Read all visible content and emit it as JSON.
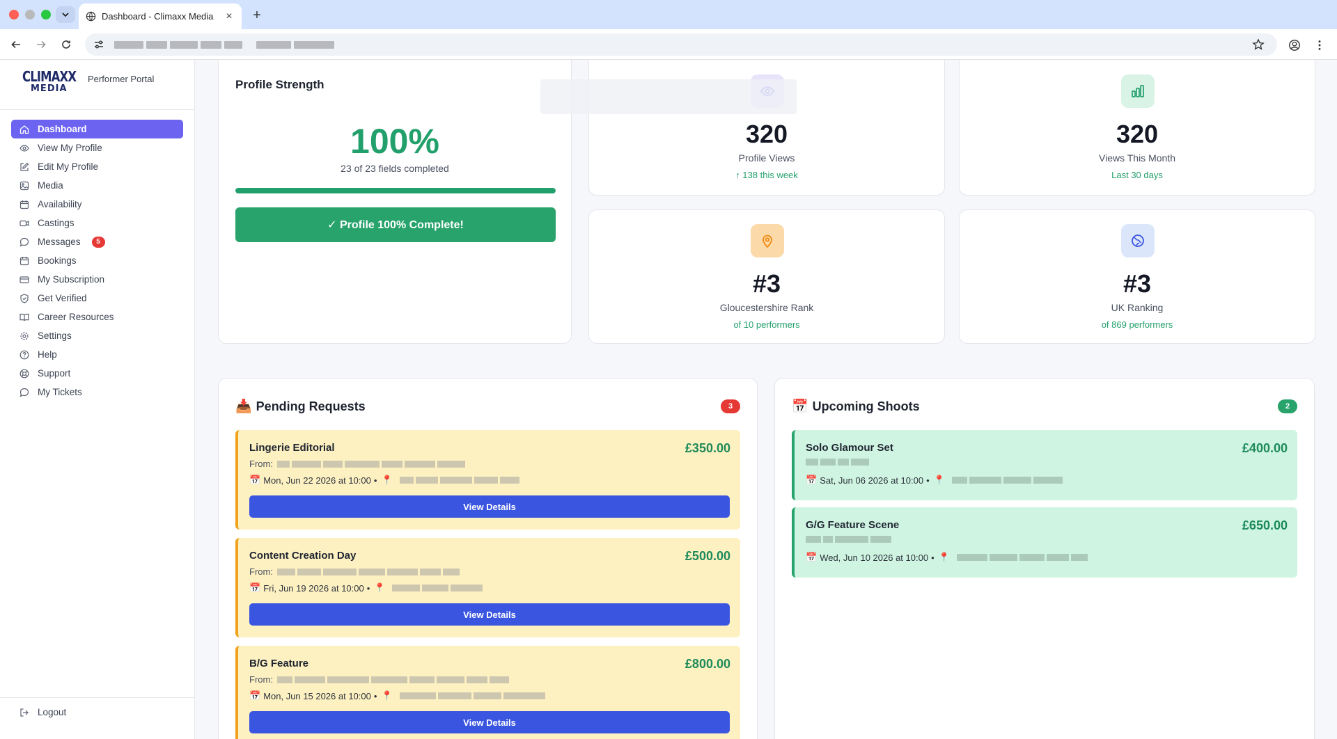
{
  "browser": {
    "tab_title": "Dashboard - Climaxx Media",
    "new_tab_symbol": "+"
  },
  "sidebar": {
    "brand_top": "CLIMAXX",
    "brand_bottom": "MEDIA",
    "portal_label": "Performer Portal",
    "items": [
      {
        "label": "Dashboard",
        "icon": "home-icon",
        "active": true
      },
      {
        "label": "View My Profile",
        "icon": "eye-icon"
      },
      {
        "label": "Edit My Profile",
        "icon": "edit-icon"
      },
      {
        "label": "Media",
        "icon": "image-icon"
      },
      {
        "label": "Availability",
        "icon": "calendar-icon"
      },
      {
        "label": "Castings",
        "icon": "video-icon"
      },
      {
        "label": "Messages",
        "icon": "chat-icon",
        "badge": "5"
      },
      {
        "label": "Bookings",
        "icon": "calendar-icon"
      },
      {
        "label": "My Subscription",
        "icon": "card-icon"
      },
      {
        "label": "Get Verified",
        "icon": "shield-check-icon"
      },
      {
        "label": "Career Resources",
        "icon": "book-icon"
      },
      {
        "label": "Settings",
        "icon": "gear-icon"
      },
      {
        "label": "Help",
        "icon": "help-icon"
      },
      {
        "label": "Support",
        "icon": "lifebuoy-icon"
      },
      {
        "label": "My Tickets",
        "icon": "chat-icon"
      }
    ],
    "logout_label": "Logout"
  },
  "profile_strength": {
    "title": "Profile Strength",
    "percent_text": "100%",
    "progress": 1.0,
    "fields_text": "23 of 23 fields completed",
    "button_label": "✓ Profile 100% Complete!"
  },
  "stats": {
    "views": {
      "value": "320",
      "label": "Profile Views",
      "sub": "↑ 138 this week",
      "icon": "eye-icon"
    },
    "month": {
      "value": "320",
      "label": "Views This Month",
      "sub": "Last 30 days",
      "icon": "bar-chart-icon"
    },
    "county": {
      "value": "#3",
      "label": "Gloucestershire Rank",
      "sub": "of 10 performers",
      "icon": "map-pin-icon"
    },
    "uk": {
      "value": "#3",
      "label": "UK Ranking",
      "sub": "of 869 performers",
      "icon": "globe-icon"
    }
  },
  "colors": {
    "accent": "#6c63f0",
    "success": "#22a06b",
    "primary_button": "#3a55e0",
    "pending_bg": "#fdf1c2",
    "shoot_bg": "#cff5e2"
  },
  "pending": {
    "emoji": "📥",
    "title": "Pending Requests",
    "count": "3",
    "from_label": "From:",
    "button_label": "View Details",
    "items": [
      {
        "title": "Lingerie Editorial",
        "price": "£350.00",
        "when": "Mon, Jun 22 2026 at 10:00"
      },
      {
        "title": "Content Creation Day",
        "price": "£500.00",
        "when": "Fri, Jun 19 2026 at 10:00"
      },
      {
        "title": "B/G Feature",
        "price": "£800.00",
        "when": "Mon, Jun 15 2026 at 10:00"
      }
    ]
  },
  "upcoming": {
    "emoji": "📅",
    "title": "Upcoming Shoots",
    "count": "2",
    "items": [
      {
        "title": "Solo Glamour Set",
        "price": "£400.00",
        "when": "Sat, Jun 06 2026 at 10:00"
      },
      {
        "title": "G/G Feature Scene",
        "price": "£650.00",
        "when": "Wed, Jun 10 2026 at 10:00"
      }
    ]
  }
}
